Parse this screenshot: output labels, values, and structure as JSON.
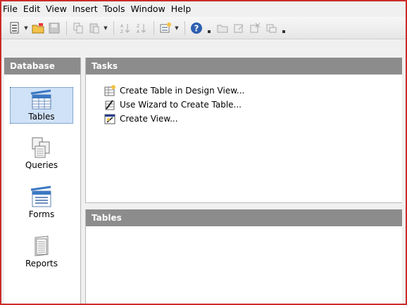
{
  "menu": {
    "file": "File",
    "edit": "Edit",
    "view": "View",
    "insert": "Insert",
    "tools": "Tools",
    "window": "Window",
    "help": "Help"
  },
  "toolbar": {
    "icons": [
      "new-document-icon",
      "open-folder-icon",
      "save-icon",
      "copy-icon",
      "paste-icon",
      "sort-ascending-icon",
      "sort-descending-icon",
      "new-form-icon",
      "help-icon",
      "open-object-icon",
      "edit-object-icon",
      "delete-object-icon",
      "rename-object-icon"
    ]
  },
  "database_pane": {
    "title": "Database",
    "items": [
      {
        "label": "Tables",
        "icon": "tables-icon",
        "selected": true
      },
      {
        "label": "Queries",
        "icon": "queries-icon",
        "selected": false
      },
      {
        "label": "Forms",
        "icon": "forms-icon",
        "selected": false
      },
      {
        "label": "Reports",
        "icon": "reports-icon",
        "selected": false
      }
    ]
  },
  "tasks_pane": {
    "title": "Tasks",
    "items": [
      {
        "label": "Create Table in Design View...",
        "icon": "design-view-icon"
      },
      {
        "label": "Use Wizard to Create Table...",
        "icon": "wizard-icon"
      },
      {
        "label": "Create View...",
        "icon": "create-view-icon"
      }
    ]
  },
  "tables_pane": {
    "title": "Tables"
  },
  "colors": {
    "header_bg": "#8c8c8c",
    "selection_bg": "#cfe2f7",
    "frame_border": "#cc2b2b",
    "icon_blue": "#3b78c3"
  }
}
